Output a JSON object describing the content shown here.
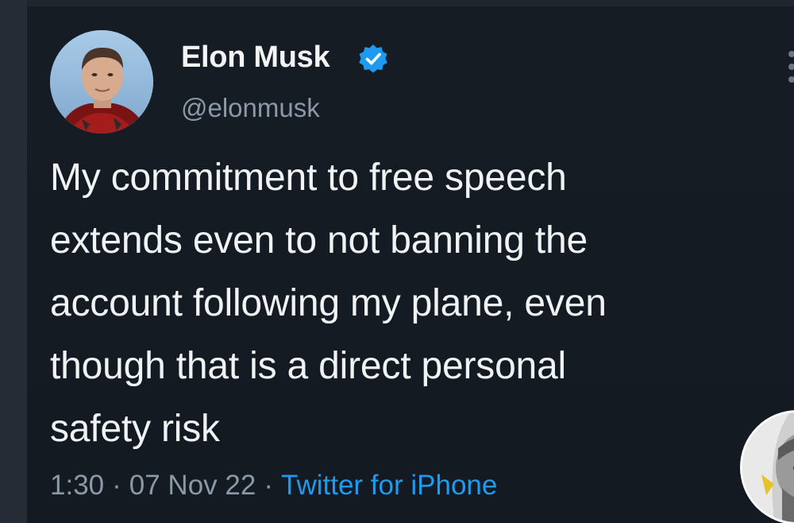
{
  "tweet": {
    "author": {
      "display_name": "Elon Musk",
      "handle": "@elonmusk",
      "verified": true,
      "avatar_icon": "profile-photo"
    },
    "text": "My commitment to free speech\nextends even to not banning the\naccount following my plane, even\nthough that is a direct personal\nsafety risk",
    "time": "1:30",
    "date": "07 Nov 22",
    "separator": "·",
    "source": "Twitter for iPhone"
  },
  "overlay": {
    "corner_avatar_icon": "watermark-avatar"
  },
  "colors": {
    "background": "#15202b",
    "text": "#eff3f4",
    "muted": "#8b98a5",
    "accent": "#1d9bf0"
  }
}
